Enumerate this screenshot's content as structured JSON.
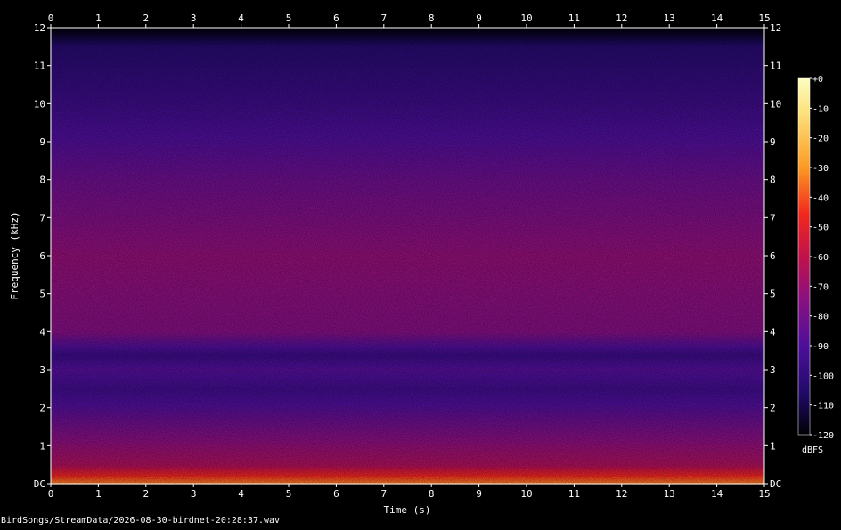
{
  "chart_data": {
    "type": "heatmap",
    "subtype": "spectrogram",
    "xlabel": "Time (s)",
    "ylabel": "Frequency (kHz)",
    "xlim": [
      0,
      15
    ],
    "ylim": [
      0,
      12
    ],
    "x_ticks": [
      "0",
      "1",
      "2",
      "3",
      "4",
      "5",
      "6",
      "7",
      "8",
      "9",
      "10",
      "11",
      "12",
      "13",
      "14",
      "15"
    ],
    "y_ticks": [
      "DC",
      "1",
      "2",
      "3",
      "4",
      "5",
      "6",
      "7",
      "8",
      "9",
      "10",
      "11",
      "12"
    ],
    "colorbar": {
      "label": "dBFS",
      "range": [
        -120,
        0
      ],
      "ticks": [
        "+0",
        "-10",
        "-20",
        "-30",
        "-40",
        "-50",
        "-60",
        "-70",
        "-80",
        "-90",
        "-100",
        "-110",
        "-120"
      ],
      "colormap": "magma-like (black → blue → purple → red → orange → yellow → white)"
    },
    "colors": {
      "background": "#000000",
      "axis": "#ffffff",
      "text": "#ffffff"
    },
    "intensity_profile_by_frequency": [
      {
        "f_khz": 0.05,
        "dbfs": -35
      },
      {
        "f_khz": 0.5,
        "dbfs": -65
      },
      {
        "f_khz": 1.0,
        "dbfs": -72
      },
      {
        "f_khz": 2.0,
        "dbfs": -88
      },
      {
        "f_khz": 2.5,
        "dbfs": -95
      },
      {
        "f_khz": 3.0,
        "dbfs": -88
      },
      {
        "f_khz": 3.4,
        "dbfs": -97
      },
      {
        "f_khz": 4.0,
        "dbfs": -76
      },
      {
        "f_khz": 6.0,
        "dbfs": -72
      },
      {
        "f_khz": 8.0,
        "dbfs": -82
      },
      {
        "f_khz": 10.0,
        "dbfs": -96
      },
      {
        "f_khz": 11.5,
        "dbfs": -104
      },
      {
        "f_khz": 12.0,
        "dbfs": -120
      }
    ]
  },
  "footer": {
    "filename": "BirdSongs/StreamData/2026-08-30-birdnet-20:28:37.wav"
  }
}
